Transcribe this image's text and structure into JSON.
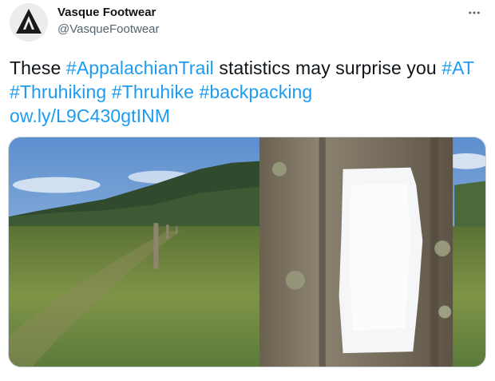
{
  "author": {
    "name": "Vasque Footwear",
    "handle": "@VasqueFootwear",
    "avatar_icon": "vasque-logo-icon"
  },
  "menu": {
    "icon": "more-icon"
  },
  "tweet": {
    "text_prefix": "These ",
    "hashtag_1": "#AppalachianTrail",
    "text_middle": " statistics may surprise you ",
    "hashtag_2": "#AT",
    "hashtag_3": "#Thruhiking",
    "hashtag_4": "#Thruhike",
    "hashtag_5": "#backpacking",
    "link": "ow.ly/L9C430gtINM"
  },
  "media": {
    "description_icon": "trail-blaze-photo",
    "colors": {
      "sky": "#8db4de",
      "grass": "#6f8a3c",
      "bark": "#7a6e5a",
      "blaze": "#f4f6f8"
    }
  },
  "colors": {
    "accent": "#1d9bf0",
    "text": "#0f1419",
    "muted": "#536471"
  }
}
